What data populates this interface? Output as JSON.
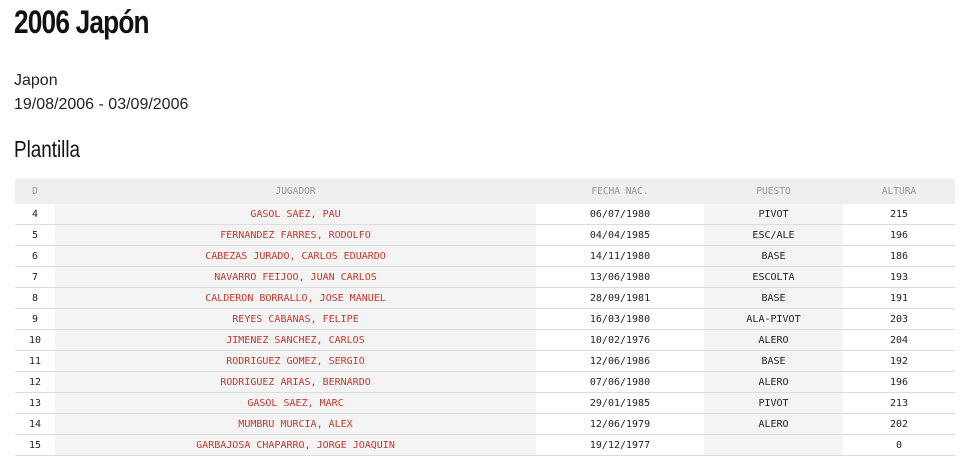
{
  "page": {
    "title": "2006 Japón",
    "country": "Japon",
    "dates": "19/08/2006 - 03/09/2006",
    "section_title": "Plantilla"
  },
  "table": {
    "headers": {
      "d": "D",
      "jugador": "JUGADOR",
      "fecha": "FECHA NAC.",
      "puesto": "PUESTO",
      "altura": "ALTURA"
    },
    "rows": [
      {
        "d": "4",
        "jugador": "GASOL SAEZ, PAU",
        "fecha": "06/07/1980",
        "puesto": "PIVOT",
        "altura": "215"
      },
      {
        "d": "5",
        "jugador": "FERNANDEZ FARRES, RODOLFO",
        "fecha": "04/04/1985",
        "puesto": "ESC/ALE",
        "altura": "196"
      },
      {
        "d": "6",
        "jugador": "CABEZAS JURADO, CARLOS EDUARDO",
        "fecha": "14/11/1980",
        "puesto": "BASE",
        "altura": "186"
      },
      {
        "d": "7",
        "jugador": "NAVARRO FEIJOO, JUAN CARLOS",
        "fecha": "13/06/1980",
        "puesto": "ESCOLTA",
        "altura": "193"
      },
      {
        "d": "8",
        "jugador": "CALDERON BORRALLO, JOSE MANUEL",
        "fecha": "28/09/1981",
        "puesto": "BASE",
        "altura": "191"
      },
      {
        "d": "9",
        "jugador": "REYES CABANAS, FELIPE",
        "fecha": "16/03/1980",
        "puesto": "ALA-PIVOT",
        "altura": "203"
      },
      {
        "d": "10",
        "jugador": "JIMENEZ SANCHEZ, CARLOS",
        "fecha": "10/02/1976",
        "puesto": "ALERO",
        "altura": "204"
      },
      {
        "d": "11",
        "jugador": "RODRIGUEZ GOMEZ, SERGIO",
        "fecha": "12/06/1986",
        "puesto": "BASE",
        "altura": "192"
      },
      {
        "d": "12",
        "jugador": "RODRIGUEZ ARIAS, BERNARDO",
        "fecha": "07/06/1980",
        "puesto": "ALERO",
        "altura": "196"
      },
      {
        "d": "13",
        "jugador": "GASOL SAEZ, MARC",
        "fecha": "29/01/1985",
        "puesto": "PIVOT",
        "altura": "213"
      },
      {
        "d": "14",
        "jugador": "MUMBRU MURCIA, ALEX",
        "fecha": "12/06/1979",
        "puesto": "ALERO",
        "altura": "202"
      },
      {
        "d": "15",
        "jugador": "GARBAJOSA CHAPARRO, JORGE JOAQUIN",
        "fecha": "19/12/1977",
        "puesto": "",
        "altura": "0"
      }
    ]
  },
  "colors": {
    "link": "#c0392b",
    "header_bg": "#eeeeee",
    "header_text": "#999999",
    "stripe": "#f4f4f4"
  }
}
